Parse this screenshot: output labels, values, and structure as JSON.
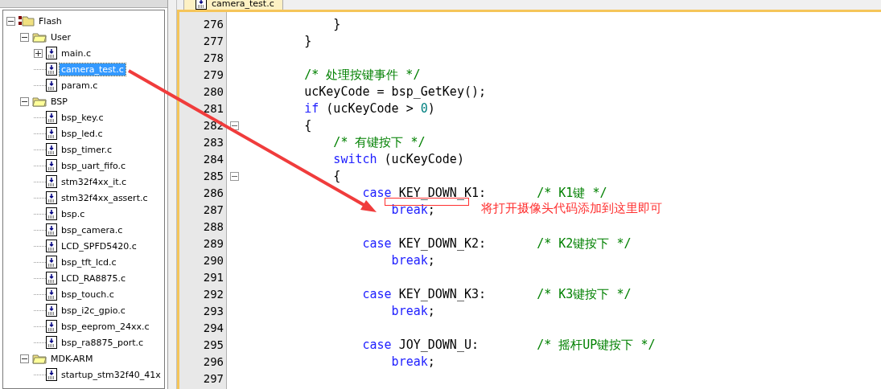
{
  "project_tree": [
    {
      "label": "Flash",
      "kind": "target",
      "expanded": true,
      "children": [
        {
          "label": "User",
          "kind": "group",
          "expanded": true,
          "children": [
            {
              "label": "main.c",
              "kind": "file",
              "expanded": false,
              "selected": false
            },
            {
              "label": "camera_test.c",
              "kind": "file",
              "selected": true
            },
            {
              "label": "param.c",
              "kind": "file",
              "selected": false
            }
          ]
        },
        {
          "label": "BSP",
          "kind": "group",
          "expanded": true,
          "children": [
            {
              "label": "bsp_key.c",
              "kind": "file",
              "selected": false
            },
            {
              "label": "bsp_led.c",
              "kind": "file",
              "selected": false
            },
            {
              "label": "bsp_timer.c",
              "kind": "file",
              "selected": false
            },
            {
              "label": "bsp_uart_fifo.c",
              "kind": "file",
              "selected": false
            },
            {
              "label": "stm32f4xx_it.c",
              "kind": "file",
              "selected": false
            },
            {
              "label": "stm32f4xx_assert.c",
              "kind": "file",
              "selected": false
            },
            {
              "label": "bsp.c",
              "kind": "file",
              "selected": false
            },
            {
              "label": "bsp_camera.c",
              "kind": "file",
              "selected": false
            },
            {
              "label": "LCD_SPFD5420.c",
              "kind": "file",
              "selected": false
            },
            {
              "label": "bsp_tft_lcd.c",
              "kind": "file",
              "selected": false
            },
            {
              "label": "LCD_RA8875.c",
              "kind": "file",
              "selected": false
            },
            {
              "label": "bsp_touch.c",
              "kind": "file",
              "selected": false
            },
            {
              "label": "bsp_i2c_gpio.c",
              "kind": "file",
              "selected": false
            },
            {
              "label": "bsp_eeprom_24xx.c",
              "kind": "file",
              "selected": false
            },
            {
              "label": "bsp_ra8875_port.c",
              "kind": "file",
              "selected": false
            }
          ]
        },
        {
          "label": "MDK-ARM",
          "kind": "group",
          "expanded": true,
          "children": [
            {
              "label": "startup_stm32f40_41x",
              "kind": "file",
              "selected": false
            }
          ]
        }
      ]
    }
  ],
  "editor": {
    "tab": {
      "label": "camera_test.c",
      "selected": true
    },
    "lines": [
      {
        "number": "276",
        "tokens": [
          {
            "kind": "plain",
            "text": "            }"
          }
        ]
      },
      {
        "number": "277",
        "tokens": [
          {
            "kind": "plain",
            "text": "        }"
          }
        ]
      },
      {
        "number": "278"
      },
      {
        "number": "279",
        "tokens": [
          {
            "kind": "comment",
            "text": "        /* 处理按键事件 */"
          }
        ]
      },
      {
        "number": "280",
        "tokens": [
          {
            "kind": "plain",
            "text": "        ucKeyCode = bsp_GetKey();"
          }
        ]
      },
      {
        "number": "281",
        "tokens": [
          {
            "kind": "keyword",
            "text": "        if"
          },
          {
            "kind": "plain",
            "text": " (ucKeyCode > "
          },
          {
            "kind": "number",
            "text": "0"
          },
          {
            "kind": "plain",
            "text": ")"
          }
        ]
      },
      {
        "number": "282",
        "fold": true,
        "tokens": [
          {
            "kind": "plain",
            "text": "        {"
          }
        ]
      },
      {
        "number": "283",
        "tokens": [
          {
            "kind": "comment",
            "text": "            /* 有键按下 */"
          }
        ]
      },
      {
        "number": "284",
        "tokens": [
          {
            "kind": "keyword",
            "text": "            switch"
          },
          {
            "kind": "plain",
            "text": " (ucKeyCode)"
          }
        ]
      },
      {
        "number": "285",
        "fold": true,
        "tokens": [
          {
            "kind": "plain",
            "text": "            {"
          }
        ]
      },
      {
        "number": "286",
        "tokens": [
          {
            "kind": "keyword",
            "text": "                case"
          },
          {
            "kind": "plain",
            "text": " KEY_DOWN_K1:       "
          },
          {
            "kind": "comment",
            "text": "/* K1键 */"
          }
        ]
      },
      {
        "number": "287",
        "tokens": [
          {
            "kind": "keyword",
            "text": "                    break"
          },
          {
            "kind": "plain",
            "text": ";"
          }
        ]
      },
      {
        "number": "288"
      },
      {
        "number": "289",
        "tokens": [
          {
            "kind": "keyword",
            "text": "                case"
          },
          {
            "kind": "plain",
            "text": " KEY_DOWN_K2:       "
          },
          {
            "kind": "comment",
            "text": "/* K2键按下 */"
          }
        ]
      },
      {
        "number": "290",
        "tokens": [
          {
            "kind": "keyword",
            "text": "                    break"
          },
          {
            "kind": "plain",
            "text": ";"
          }
        ]
      },
      {
        "number": "291"
      },
      {
        "number": "292",
        "tokens": [
          {
            "kind": "keyword",
            "text": "                case"
          },
          {
            "kind": "plain",
            "text": " KEY_DOWN_K3:       "
          },
          {
            "kind": "comment",
            "text": "/* K3键按下 */"
          }
        ]
      },
      {
        "number": "293",
        "tokens": [
          {
            "kind": "keyword",
            "text": "                    break"
          },
          {
            "kind": "plain",
            "text": ";"
          }
        ]
      },
      {
        "number": "294"
      },
      {
        "number": "295",
        "tokens": [
          {
            "kind": "keyword",
            "text": "                case"
          },
          {
            "kind": "plain",
            "text": " JOY_DOWN_U:        "
          },
          {
            "kind": "comment",
            "text": "/* 摇杆UP键按下 */"
          }
        ]
      },
      {
        "number": "296",
        "tokens": [
          {
            "kind": "keyword",
            "text": "                    break"
          },
          {
            "kind": "plain",
            "text": ";"
          }
        ]
      },
      {
        "number": "297"
      }
    ]
  },
  "annotation": {
    "text": "将打开摄像头代码添加到这里即可"
  }
}
